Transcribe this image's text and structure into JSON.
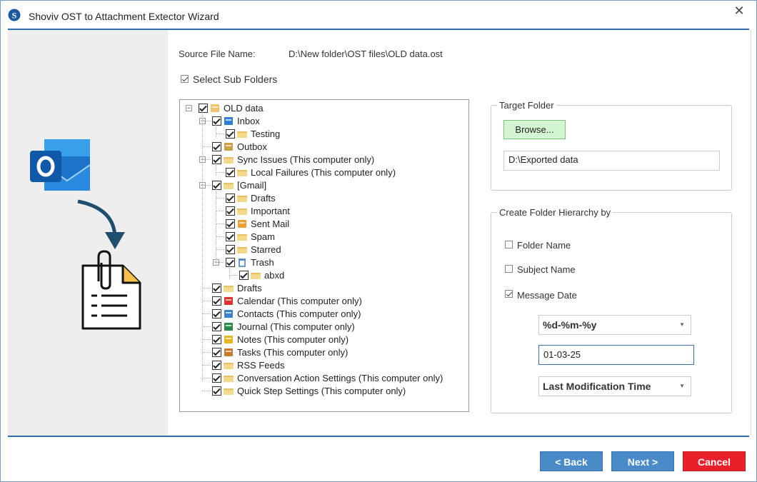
{
  "window": {
    "title": "Shoviv OST to Attachment Extector Wizard",
    "close_glyph": "✕",
    "logo_letter": "S"
  },
  "source": {
    "label": "Source File Name:",
    "value": "D:\\New folder\\OST files\\OLD data.ost"
  },
  "select_sub_folders": {
    "label": "Select Sub Folders",
    "checked": true
  },
  "tree": [
    {
      "label": "OLD data",
      "icon": "mailbox-icon"
    },
    {
      "label": "Inbox",
      "icon": "inbox-icon"
    },
    {
      "label": "Testing",
      "icon": "folder-icon"
    },
    {
      "label": "Outbox",
      "icon": "outbox-icon"
    },
    {
      "label": "Sync Issues (This computer only)",
      "icon": "folder-icon"
    },
    {
      "label": "Local Failures (This computer only)",
      "icon": "folder-icon"
    },
    {
      "label": "[Gmail]",
      "icon": "folder-icon"
    },
    {
      "label": "Drafts",
      "icon": "folder-icon"
    },
    {
      "label": "Important",
      "icon": "folder-icon"
    },
    {
      "label": "Sent Mail",
      "icon": "sent-mail-icon"
    },
    {
      "label": "Spam",
      "icon": "folder-icon"
    },
    {
      "label": "Starred",
      "icon": "folder-icon"
    },
    {
      "label": "Trash",
      "icon": "trash-icon"
    },
    {
      "label": "abxd",
      "icon": "folder-icon"
    },
    {
      "label": "Drafts",
      "icon": "folder-icon"
    },
    {
      "label": "Calendar (This computer only)",
      "icon": "calendar-icon"
    },
    {
      "label": "Contacts (This computer only)",
      "icon": "contacts-icon"
    },
    {
      "label": "Journal (This computer only)",
      "icon": "journal-icon"
    },
    {
      "label": "Notes (This computer only)",
      "icon": "notes-icon"
    },
    {
      "label": "Tasks (This computer only)",
      "icon": "tasks-icon"
    },
    {
      "label": "RSS Feeds",
      "icon": "folder-icon"
    },
    {
      "label": "Conversation Action Settings (This computer only)",
      "icon": "folder-icon"
    },
    {
      "label": "Quick Step Settings (This computer only)",
      "icon": "folder-icon"
    }
  ],
  "target": {
    "group_title": "Target Folder",
    "browse_label": "Browse...",
    "path_value": "D:\\Exported data"
  },
  "hierarchy": {
    "group_title": "Create Folder Hierarchy by",
    "folder_name": {
      "label": "Folder Name",
      "checked": false
    },
    "subject_name": {
      "label": "Subject Name",
      "checked": false
    },
    "message_date": {
      "label": "Message Date",
      "checked": true
    },
    "date_format": "%d-%m-%y",
    "date_preview": "01-03-25",
    "time_type": "Last Modification Time"
  },
  "buttons": {
    "back": "< Back",
    "next": "Next >",
    "cancel": "Cancel"
  },
  "colors": {
    "accent": "#2f6cae",
    "button_blue": "#4a8ac9",
    "button_red": "#e8202a",
    "browse_green": "#d4f5d2"
  }
}
